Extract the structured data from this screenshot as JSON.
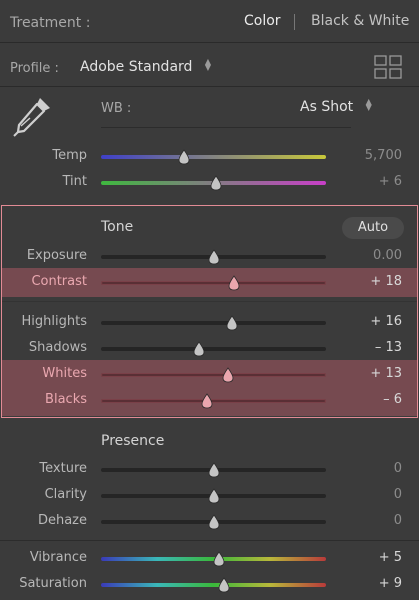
{
  "header": {
    "treatment_label": "Treatment :",
    "color_label": "Color",
    "bw_label": "Black & White"
  },
  "profile": {
    "label": "Profile :",
    "value": "Adobe Standard"
  },
  "wb": {
    "label": "WB :",
    "value": "As Shot"
  },
  "wb_rows": [
    {
      "key": "temp",
      "label": "Temp",
      "value": "5,700",
      "level": 0.37,
      "gradient": "#3f40c8,#c8c83a"
    },
    {
      "key": "tint",
      "label": "Tint",
      "value": "+ 6",
      "level": 0.51,
      "gradient": "#3fb83f,#c83fc8"
    }
  ],
  "tone": {
    "title": "Tone",
    "auto_label": "Auto"
  },
  "tone_rows": [
    {
      "key": "exposure",
      "label": "Exposure",
      "value": "0.00",
      "level": 0.5,
      "highlighted": false
    },
    {
      "key": "contrast",
      "label": "Contrast",
      "value": "+ 18",
      "level": 0.59,
      "highlighted": true
    },
    {
      "key": "highlights",
      "label": "Highlights",
      "value": "+ 16",
      "level": 0.58,
      "highlighted": false
    },
    {
      "key": "shadows",
      "label": "Shadows",
      "value": "– 13",
      "level": 0.435,
      "highlighted": false
    },
    {
      "key": "whites",
      "label": "Whites",
      "value": "+ 13",
      "level": 0.565,
      "highlighted": true
    },
    {
      "key": "blacks",
      "label": "Blacks",
      "value": "– 6",
      "level": 0.47,
      "highlighted": true
    }
  ],
  "presence": {
    "title": "Presence"
  },
  "presence_rows": [
    {
      "key": "texture",
      "label": "Texture",
      "value": "0",
      "level": 0.5,
      "colored": false
    },
    {
      "key": "clarity",
      "label": "Clarity",
      "value": "0",
      "level": 0.5,
      "colored": false
    },
    {
      "key": "dehaze",
      "label": "Dehaze",
      "value": "0",
      "level": 0.5,
      "colored": false
    },
    {
      "key": "vibrance",
      "label": "Vibrance",
      "value": "+ 5",
      "level": 0.525,
      "colored": true
    },
    {
      "key": "saturation",
      "label": "Saturation",
      "value": "+ 9",
      "level": 0.545,
      "colored": true
    }
  ],
  "colors": {
    "highlight": "#e28b95",
    "thumb_normal": "#c4c4c4",
    "thumb_highlight": "#eaa6ae",
    "spectrum": "#3a3ab8,#3ab8b8,#3ab83a,#b8b83a,#b83a3a"
  },
  "icons": {
    "picker": "eyedropper-icon",
    "grid": "grid-view-icon",
    "updown": "chevron-updown-icon"
  }
}
